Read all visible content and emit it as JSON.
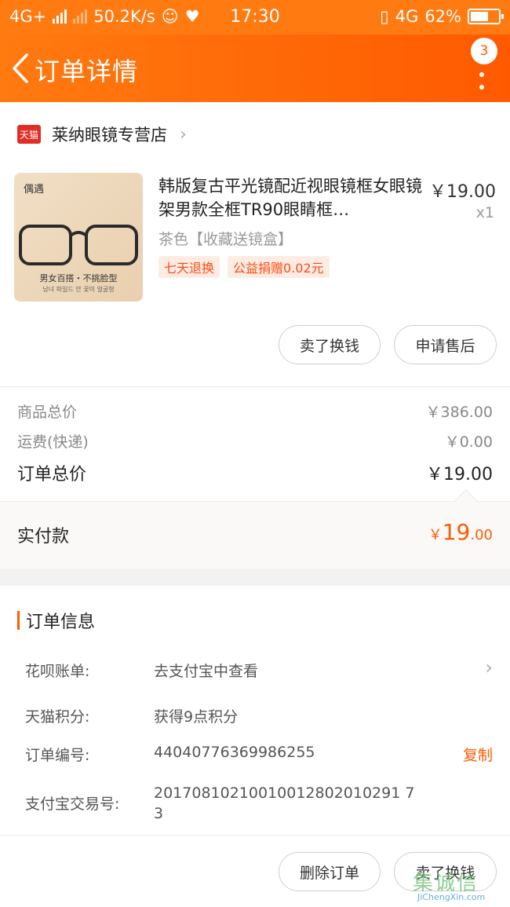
{
  "status_bar": {
    "network": "4G+",
    "speed": "50.2K/s",
    "time": "17:30",
    "network_right": "4G",
    "battery": "62%"
  },
  "header": {
    "title": "订单详情",
    "badge_count": "3"
  },
  "shop": {
    "logo_text": "天猫",
    "name": "莱纳眼镜专营店"
  },
  "product": {
    "image_brand": "偶遇",
    "image_tag": "男女百搭・不挑脸型",
    "image_subtag": "남녀 파일드 안 꽃미 얼굴형",
    "title": "韩版复古平光镜配近视眼镜框女眼镜架男款全框TR90眼睛框…",
    "price": "￥19.00",
    "qty": "x1",
    "sku": "茶色【收藏送镜盒】",
    "tags": [
      "七天退换",
      "公益捐赠0.02元"
    ]
  },
  "item_actions": {
    "sell_label": "卖了换钱",
    "after_sale_label": "申请售后"
  },
  "price_summary": {
    "goods_label": "商品总价",
    "goods_value": "￥386.00",
    "shipping_label": "运费(快递)",
    "shipping_value": "￥0.00",
    "total_label": "订单总价",
    "total_value": "￥19.00",
    "paid_label": "实付款",
    "paid_symbol": "￥",
    "paid_int": "19",
    "paid_dec": ".00"
  },
  "order_info": {
    "title": "订单信息",
    "huabei_label": "花呗账单:",
    "huabei_value": "去支付宝中查看",
    "points_label": "天猫积分:",
    "points_value": "获得9点积分",
    "order_no_label": "订单编号:",
    "order_no_value": "44040776369986255",
    "copy_label": "复制",
    "alipay_label": "支付宝交易号:",
    "alipay_value_line1": "20170810210010012802010291 7",
    "alipay_value_line2": "3"
  },
  "bottom_bar": {
    "delete_label": "删除订单",
    "sell_label": "卖了换钱"
  },
  "watermark": {
    "main": "集诚信",
    "sub": "JiChengXin.com"
  },
  "colors": {
    "brand_orange": "#ff5a00",
    "tmall_red": "#e02e24",
    "tag_bg": "#fdece4"
  }
}
